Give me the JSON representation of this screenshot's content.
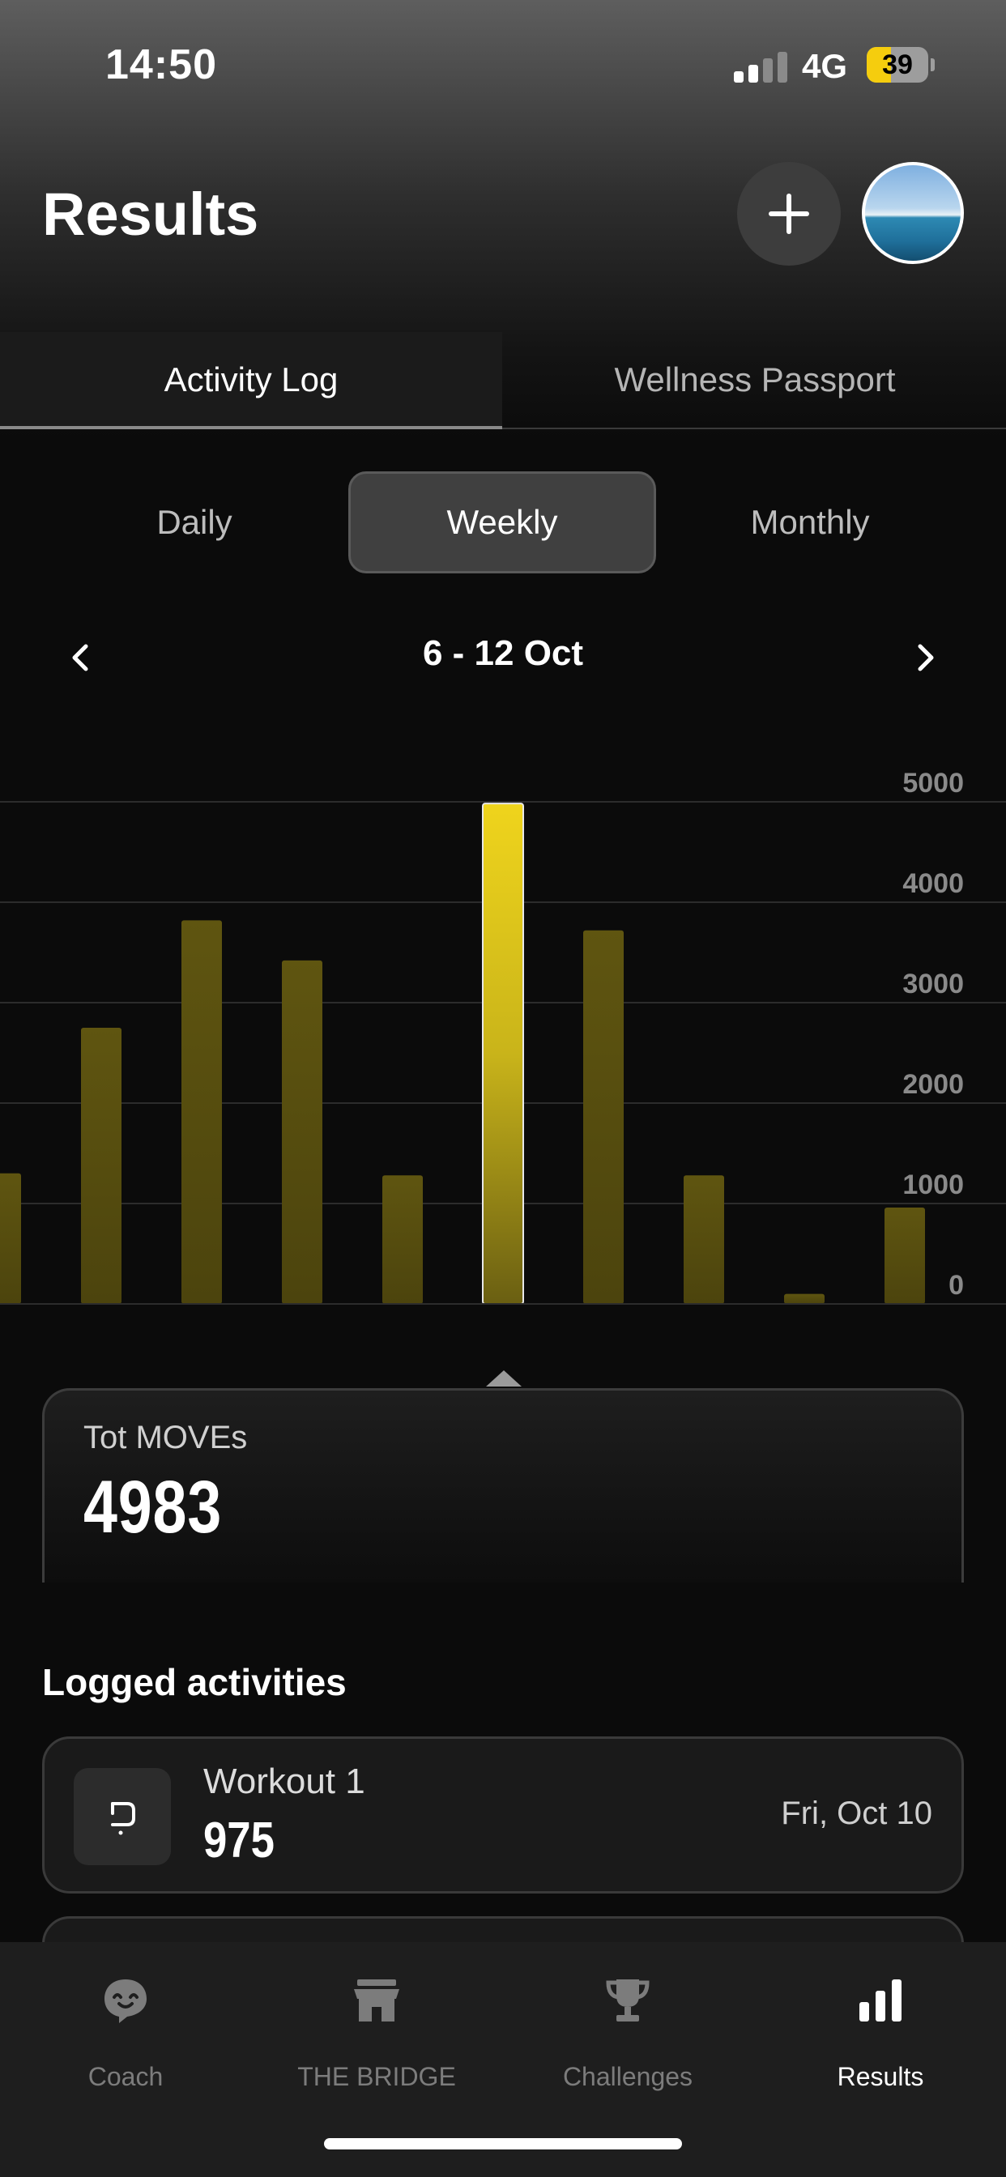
{
  "status_bar": {
    "time": "14:50",
    "network": "4G",
    "battery": "39"
  },
  "header": {
    "title": "Results",
    "add_icon": "plus-icon",
    "avatar": "profile-avatar"
  },
  "main_tabs": [
    {
      "label": "Activity Log",
      "active": true
    },
    {
      "label": "Wellness Passport",
      "active": false
    }
  ],
  "period_tabs": [
    {
      "label": "Daily",
      "active": false
    },
    {
      "label": "Weekly",
      "active": true
    },
    {
      "label": "Monthly",
      "active": false
    }
  ],
  "date_range": {
    "label": "6 - 12 Oct",
    "prev_icon": "chevron-left-icon",
    "next_icon": "chevron-right-icon"
  },
  "chart_data": {
    "type": "bar",
    "y_ticks": [
      "5000",
      "4000",
      "3000",
      "2000",
      "1000",
      "0"
    ],
    "ylim": [
      0,
      5000
    ],
    "values": [
      1300,
      2750,
      3820,
      3420,
      1280,
      4983,
      3720,
      1280,
      100,
      960
    ],
    "selected_index": 5,
    "grid": true,
    "bar_color": "#c9b41a"
  },
  "total": {
    "label": "Tot MOVEs",
    "value": "4983"
  },
  "logged": {
    "title": "Logged activities",
    "items": [
      {
        "name": "Workout 1",
        "value": "975",
        "date": "Fri, Oct 10",
        "icon": "workout-icon"
      }
    ]
  },
  "bottom_nav": [
    {
      "label": "Coach",
      "icon": "coach-icon",
      "active": false
    },
    {
      "label": "THE BRIDGE",
      "icon": "store-icon",
      "active": false
    },
    {
      "label": "Challenges",
      "icon": "trophy-icon",
      "active": false
    },
    {
      "label": "Results",
      "icon": "bar-chart-icon",
      "active": true
    }
  ],
  "colors": {
    "accent": "#f5cd0e",
    "bar": "#c9b41a",
    "background": "#0b0b0b"
  }
}
